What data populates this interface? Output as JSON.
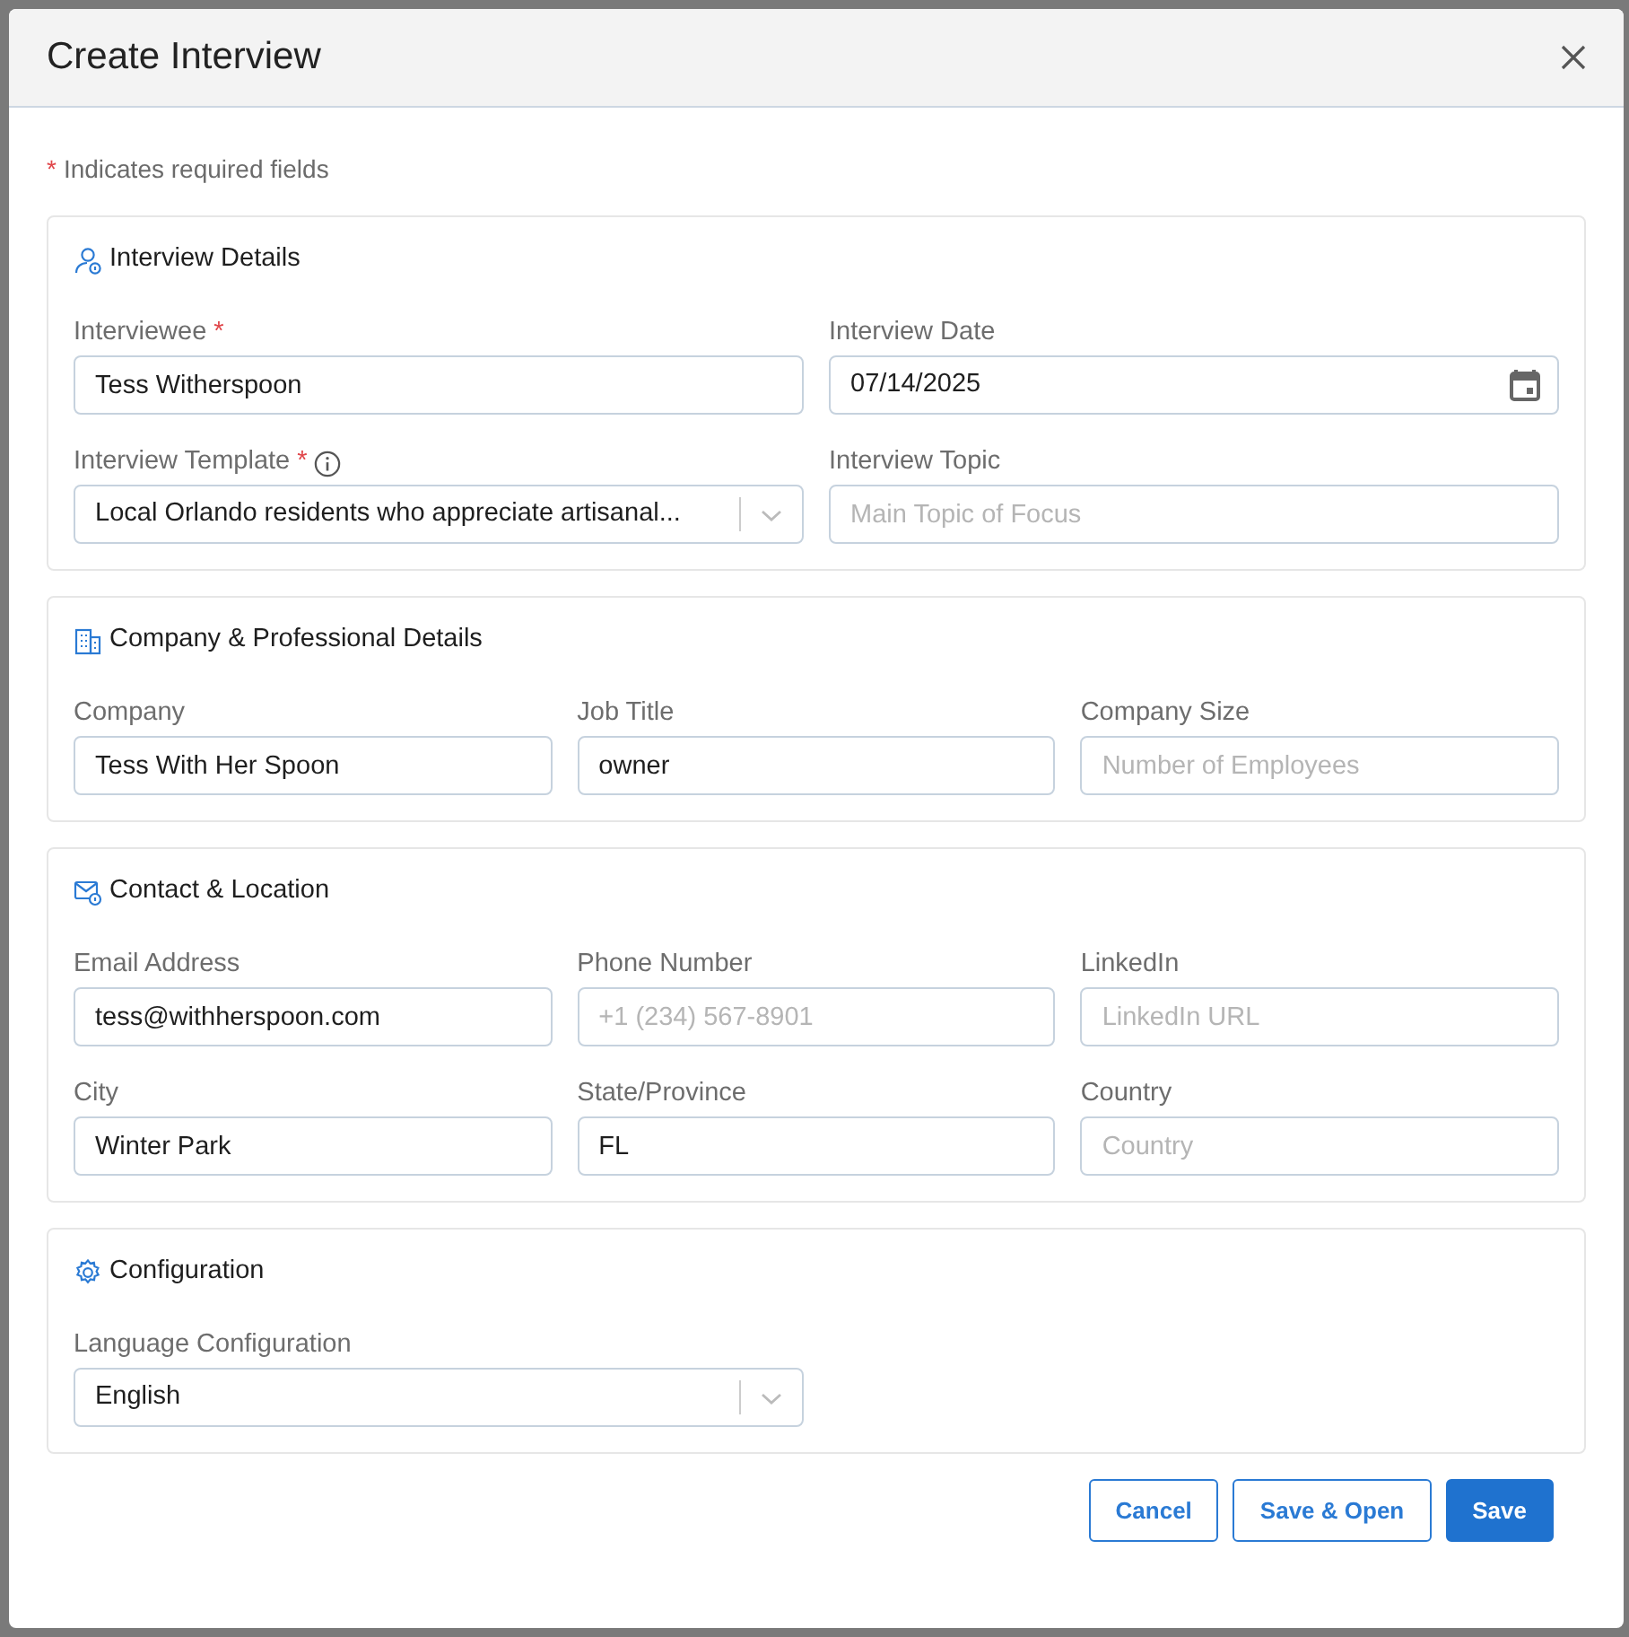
{
  "dialog": {
    "title": "Create Interview"
  },
  "required_note": {
    "mark": "*",
    "text": "Indicates required fields"
  },
  "sections": [
    {
      "kind": "person",
      "title": "Interview Details",
      "fields": [
        {
          "label": "Interviewee",
          "required_mark": "*",
          "kind": "text",
          "value": "Tess Witherspoon"
        },
        {
          "label": "Interview Date",
          "kind": "date",
          "value": "07/14/2025"
        },
        {
          "label": "Interview Template",
          "required_mark": "*",
          "info": true,
          "kind": "select",
          "value": "Local Orlando residents who appreciate artisanal..."
        },
        {
          "label": "Interview Topic",
          "kind": "text",
          "placeholder": "Main Topic of Focus"
        }
      ]
    },
    {
      "kind": "building",
      "title": "Company & Professional Details",
      "fields": [
        {
          "label": "Company",
          "kind": "text",
          "value": "Tess With Her Spoon"
        },
        {
          "label": "Job Title",
          "kind": "text",
          "value": "owner"
        },
        {
          "label": "Company Size",
          "kind": "text",
          "placeholder": "Number of Employees"
        }
      ]
    },
    {
      "kind": "mail",
      "title": "Contact & Location",
      "fields": [
        {
          "label": "Email Address",
          "kind": "text",
          "value": "tess@withherspoon.com"
        },
        {
          "label": "Phone Number",
          "kind": "text",
          "placeholder": "+1 (234) 567-8901"
        },
        {
          "label": "LinkedIn",
          "kind": "text",
          "placeholder": "LinkedIn URL"
        },
        {
          "label": "City",
          "kind": "text",
          "value": "Winter Park"
        },
        {
          "label": "State/Province",
          "kind": "text",
          "value": "FL"
        },
        {
          "label": "Country",
          "kind": "text",
          "placeholder": "Country"
        }
      ]
    },
    {
      "kind": "gear",
      "title": "Configuration",
      "fields": [
        {
          "label": "Language Configuration",
          "kind": "select",
          "value": "English"
        }
      ]
    }
  ],
  "buttons": [
    {
      "label": "Cancel",
      "kind": "outline"
    },
    {
      "label": "Save & Open",
      "kind": "outline"
    },
    {
      "label": "Save",
      "kind": "primary"
    }
  ]
}
